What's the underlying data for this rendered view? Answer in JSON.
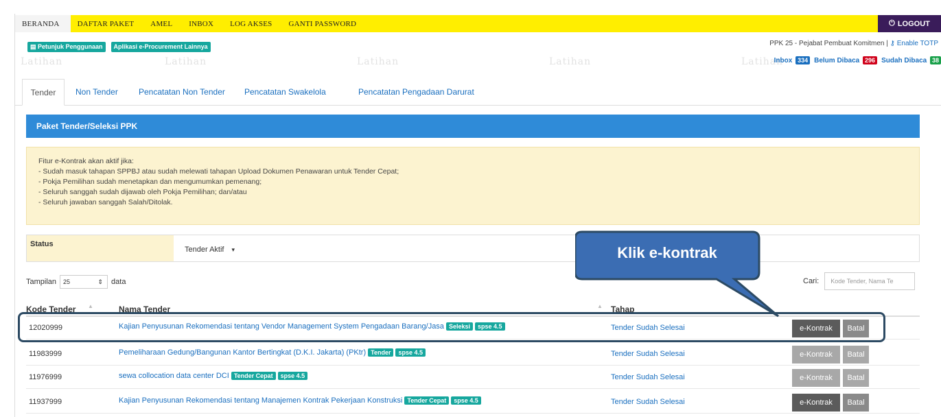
{
  "nav": {
    "items": [
      "BERANDA",
      "DAFTAR PAKET",
      "AMEL",
      "INBOX",
      "LOG AKSES",
      "GANTI PASSWORD"
    ],
    "logout": "LOGOUT"
  },
  "sublinks": [
    "Petunjuk Penggunaan",
    "Aplikasi e-Procurement Lainnya"
  ],
  "user": {
    "role": "PPK 25 - Pejabat Pembuat Komitmen |",
    "totp": "Enable TOTP"
  },
  "inbox": {
    "inbox_label": "Inbox",
    "inbox_count": "334",
    "unread_label": "Belum Dibaca",
    "unread_count": "296",
    "read_label": "Sudah Dibaca",
    "read_count": "38"
  },
  "watermark": "Latihan",
  "tabs": [
    "Tender",
    "Non Tender",
    "Pencatatan Non Tender",
    "Pencatatan Swakelola",
    "Pencatatan Pengadaan Darurat"
  ],
  "panel_title": "Paket Tender/Seleksi PPK",
  "notice": [
    "Fitur e-Kontrak akan aktif jika:",
    "- Sudah masuk tahapan SPPBJ atau sudah melewati tahapan Upload Dokumen Penawaran untuk Tender Cepat;",
    "- Pokja Pemilihan sudah menetapkan dan mengumumkan pemenang;",
    "- Seluruh sanggah sudah dijawab oleh Pokja Pemilihan; dan/atau",
    "- Seluruh jawaban sanggah Salah/Ditolak."
  ],
  "status": {
    "label": "Status",
    "value": "Tender Aktif"
  },
  "tampilan": {
    "label": "Tampilan",
    "value": "25",
    "suffix": "data"
  },
  "search": {
    "label": "Cari:",
    "placeholder": "Kode Tender, Nama Te"
  },
  "table": {
    "headers": [
      "Kode Tender",
      "Nama Tender",
      "Tahap"
    ],
    "rows": [
      {
        "kode": "12020999",
        "nama": "Kajian Penyusunan Rekomendasi tentang Vendor Management System Pengadaan Barang/Jasa",
        "tags": [
          "Seleksi",
          "spse 4.5"
        ],
        "tahap": "Tender Sudah Selesai",
        "btn1": "e-Kontrak",
        "btn2": "Batal"
      },
      {
        "kode": "11983999",
        "nama": "Pemeliharaan Gedung/Bangunan Kantor Bertingkat (D.K.I. Jakarta) (PKtr)",
        "tags": [
          "Tender",
          "spse 4.5"
        ],
        "tahap": "Tender Sudah Selesai",
        "btn1": "e-Kontrak",
        "btn2": "Batal"
      },
      {
        "kode": "11976999",
        "nama": "sewa collocation data center DCI",
        "tags": [
          "Tender Cepat",
          "spse 4.5"
        ],
        "tahap": "Tender Sudah Selesai",
        "btn1": "e-Kontrak",
        "btn2": "Batal"
      },
      {
        "kode": "11937999",
        "nama": "Kajian Penyusunan Rekomendasi tentang Manajemen Kontrak Pekerjaan Konstruksi",
        "tags": [
          "Tender Cepat",
          "spse 4.5"
        ],
        "tahap": "Tender Sudah Selesai",
        "btn1": "e-Kontrak",
        "btn2": "Batal"
      }
    ]
  },
  "callout": "Klik e-kontrak",
  "colors": {
    "nav_bg": "#ffee00",
    "logout_bg": "#3a1c5a",
    "panel_head": "#2f8bd8",
    "notice_bg": "#fcf3d0",
    "tag": "#16a79e",
    "link": "#1a6fbf",
    "callout": "#3b6db3"
  }
}
